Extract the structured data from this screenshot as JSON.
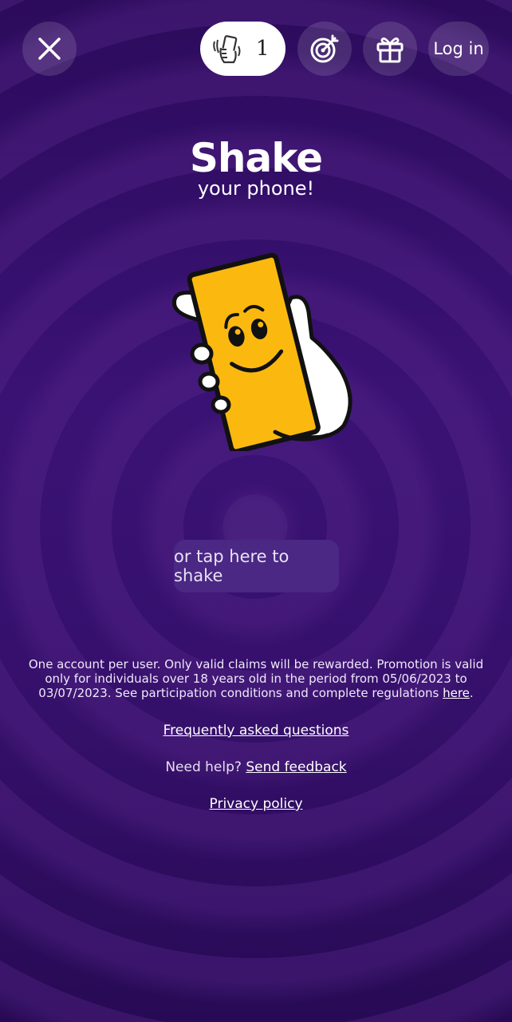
{
  "colors": {
    "background_top": "#2c0b5c",
    "background_mid": "#3a1275",
    "accent_phone": "#fbb90f",
    "button_translucent": "rgba(255,255,255,0.13)",
    "tap_button": "#4a2884"
  },
  "topbar": {
    "close_icon": "close-icon",
    "shake_counter": {
      "icon": "hand-shaking-phone-icon",
      "value": "1"
    },
    "target_icon": "target-icon",
    "gift_icon": "gift-icon",
    "login_label": "Log in"
  },
  "heading": {
    "title": "Shake",
    "subtitle": "your phone!"
  },
  "illustration": {
    "icon": "hand-holding-smiling-phone-icon"
  },
  "tap_button": {
    "label": "or tap here to shake"
  },
  "legal": {
    "text": "One account per user. Only valid claims will be rewarded. Promotion is valid only for individuals over 18 years old in the period from 05/06/2023 to 03/07/2023. See participation conditions and complete regulations ",
    "link": "here",
    "suffix": "."
  },
  "footer": {
    "faq_label": "Frequently asked questions",
    "help_prefix": "Need help?",
    "feedback_label": "Send feedback",
    "privacy_label": "Privacy policy"
  }
}
